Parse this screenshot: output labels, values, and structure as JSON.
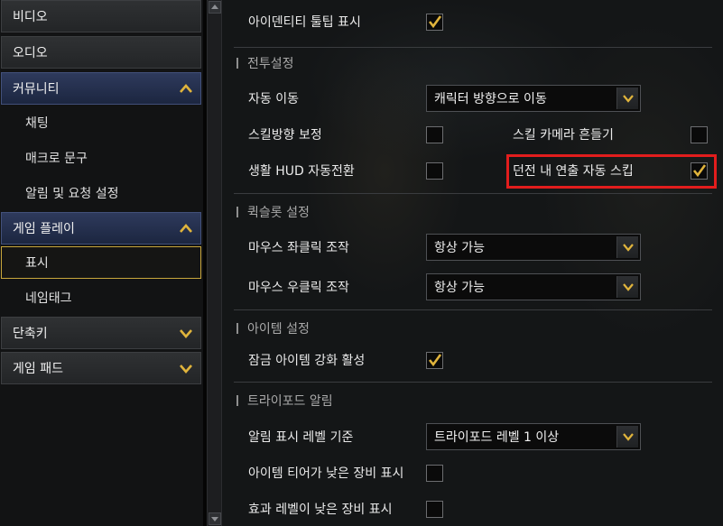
{
  "sidebar": {
    "items": [
      {
        "label": "비디오",
        "type": "main"
      },
      {
        "label": "오디오",
        "type": "main"
      },
      {
        "label": "커뮤니티",
        "type": "main",
        "expanded": true
      },
      {
        "label": "채팅",
        "type": "sub"
      },
      {
        "label": "매크로 문구",
        "type": "sub"
      },
      {
        "label": "알림 및 요청 설정",
        "type": "sub"
      },
      {
        "label": "게임 플레이",
        "type": "main",
        "expanded": true
      },
      {
        "label": "표시",
        "type": "sub",
        "selected": true
      },
      {
        "label": "네임태그",
        "type": "sub"
      },
      {
        "label": "단축키",
        "type": "main",
        "expanded": false
      },
      {
        "label": "게임 패드",
        "type": "main",
        "expanded": false
      }
    ]
  },
  "settings": {
    "identity_tooltip": {
      "label": "아이덴티티 툴팁 표시",
      "checked": true
    },
    "combat": {
      "title": "전투설정",
      "auto_move": {
        "label": "자동 이동",
        "value": "캐릭터 방향으로 이동"
      },
      "skill_direction": {
        "label": "스킬방향 보정",
        "checked": false
      },
      "skill_camera_shake": {
        "label": "스킬 카메라 흔들기",
        "checked": false
      },
      "life_hud": {
        "label": "생활 HUD 자동전환",
        "checked": false
      },
      "dungeon_skip": {
        "label": "던전 내 연출 자동 스킵",
        "checked": true
      }
    },
    "quickslot": {
      "title": "퀵슬롯 설정",
      "left_click": {
        "label": "마우스 좌클릭 조작",
        "value": "항상 가능"
      },
      "right_click": {
        "label": "마우스 우클릭 조작",
        "value": "항상 가능"
      }
    },
    "item": {
      "title": "아이템 설정",
      "locked_enhance": {
        "label": "잠금 아이템 강화 활성",
        "checked": true
      }
    },
    "tripod": {
      "title": "트라이포드 알림",
      "alert_level": {
        "label": "알림 표시 레벨 기준",
        "value": "트라이포드 레벨 1 이상"
      },
      "low_tier": {
        "label": "아이템 티어가 낮은 장비 표시",
        "checked": false
      },
      "low_effect": {
        "label": "효과 레벨이 낮은 장비 표시",
        "checked": false
      }
    }
  },
  "colors": {
    "accent_gold": "#e0b43c",
    "highlight_red": "#e21d1d",
    "nav_open_blue": "#2e3a5c"
  },
  "icons": {
    "expanded": "chevron-up-icon",
    "collapsed": "chevron-down-icon",
    "check": "check-icon",
    "dropdown": "dropdown-arrow-icon"
  }
}
